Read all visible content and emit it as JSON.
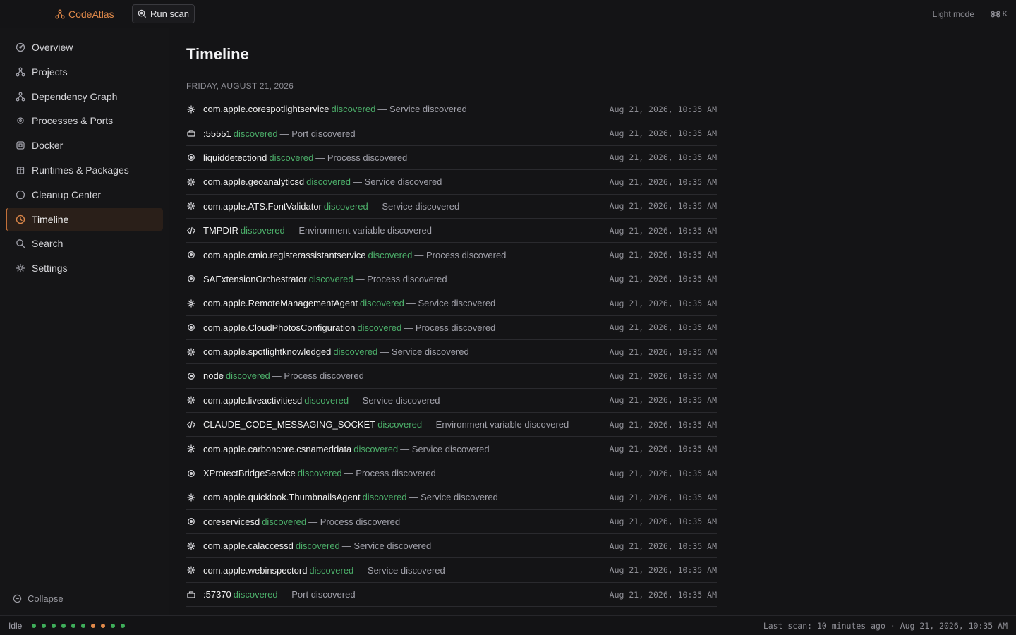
{
  "app": {
    "name": "CodeAtlas",
    "run_scan_label": "Run scan",
    "light_mode_label": "Light mode",
    "shortcut_key": "K",
    "accent_color": "#e0894a"
  },
  "sidebar": {
    "items": [
      {
        "label": "Overview",
        "icon": "overview-icon"
      },
      {
        "label": "Projects",
        "icon": "projects-icon"
      },
      {
        "label": "Dependency Graph",
        "icon": "graph-icon"
      },
      {
        "label": "Processes & Ports",
        "icon": "process-icon"
      },
      {
        "label": "Docker",
        "icon": "docker-icon"
      },
      {
        "label": "Runtimes & Packages",
        "icon": "package-icon"
      },
      {
        "label": "Cleanup Center",
        "icon": "cleanup-icon"
      },
      {
        "label": "Timeline",
        "icon": "clock-icon",
        "active": true
      },
      {
        "label": "Search",
        "icon": "search-icon"
      },
      {
        "label": "Settings",
        "icon": "gear-icon"
      }
    ],
    "collapse_label": "Collapse"
  },
  "main": {
    "title": "Timeline",
    "date_header": "FRIDAY, AUGUST 21, 2026",
    "events": [
      {
        "type": "service",
        "name": "com.apple.corespotlightservice",
        "verb": "discovered",
        "desc": "— Service discovered",
        "time": "Aug 21, 2026, 10:35 AM"
      },
      {
        "type": "port",
        "name": ":55551",
        "verb": "discovered",
        "desc": "— Port discovered",
        "time": "Aug 21, 2026, 10:35 AM"
      },
      {
        "type": "process",
        "name": "liquiddetectiond",
        "verb": "discovered",
        "desc": "— Process discovered",
        "time": "Aug 21, 2026, 10:35 AM"
      },
      {
        "type": "service",
        "name": "com.apple.geoanalyticsd",
        "verb": "discovered",
        "desc": "— Service discovered",
        "time": "Aug 21, 2026, 10:35 AM"
      },
      {
        "type": "service",
        "name": "com.apple.ATS.FontValidator",
        "verb": "discovered",
        "desc": "— Service discovered",
        "time": "Aug 21, 2026, 10:35 AM"
      },
      {
        "type": "env",
        "name": "TMPDIR",
        "verb": "discovered",
        "desc": "— Environment variable discovered",
        "time": "Aug 21, 2026, 10:35 AM"
      },
      {
        "type": "process",
        "name": "com.apple.cmio.registerassistantservice",
        "verb": "discovered",
        "desc": "— Process discovered",
        "time": "Aug 21, 2026, 10:35 AM"
      },
      {
        "type": "process",
        "name": "SAExtensionOrchestrator",
        "verb": "discovered",
        "desc": "— Process discovered",
        "time": "Aug 21, 2026, 10:35 AM"
      },
      {
        "type": "service",
        "name": "com.apple.RemoteManagementAgent",
        "verb": "discovered",
        "desc": "— Service discovered",
        "time": "Aug 21, 2026, 10:35 AM"
      },
      {
        "type": "process",
        "name": "com.apple.CloudPhotosConfiguration",
        "verb": "discovered",
        "desc": "— Process discovered",
        "time": "Aug 21, 2026, 10:35 AM"
      },
      {
        "type": "service",
        "name": "com.apple.spotlightknowledged",
        "verb": "discovered",
        "desc": "— Service discovered",
        "time": "Aug 21, 2026, 10:35 AM"
      },
      {
        "type": "process",
        "name": "node",
        "verb": "discovered",
        "desc": "— Process discovered",
        "time": "Aug 21, 2026, 10:35 AM"
      },
      {
        "type": "service",
        "name": "com.apple.liveactivitiesd",
        "verb": "discovered",
        "desc": "— Service discovered",
        "time": "Aug 21, 2026, 10:35 AM"
      },
      {
        "type": "env",
        "name": "CLAUDE_CODE_MESSAGING_SOCKET",
        "verb": "discovered",
        "desc": "— Environment variable discovered",
        "time": "Aug 21, 2026, 10:35 AM"
      },
      {
        "type": "service",
        "name": "com.apple.carboncore.csnameddata",
        "verb": "discovered",
        "desc": "— Service discovered",
        "time": "Aug 21, 2026, 10:35 AM"
      },
      {
        "type": "process",
        "name": "XProtectBridgeService",
        "verb": "discovered",
        "desc": "— Process discovered",
        "time": "Aug 21, 2026, 10:35 AM"
      },
      {
        "type": "service",
        "name": "com.apple.quicklook.ThumbnailsAgent",
        "verb": "discovered",
        "desc": "— Service discovered",
        "time": "Aug 21, 2026, 10:35 AM"
      },
      {
        "type": "process",
        "name": "coreservicesd",
        "verb": "discovered",
        "desc": "— Process discovered",
        "time": "Aug 21, 2026, 10:35 AM"
      },
      {
        "type": "service",
        "name": "com.apple.calaccessd",
        "verb": "discovered",
        "desc": "— Service discovered",
        "time": "Aug 21, 2026, 10:35 AM"
      },
      {
        "type": "service",
        "name": "com.apple.webinspectord",
        "verb": "discovered",
        "desc": "— Service discovered",
        "time": "Aug 21, 2026, 10:35 AM"
      },
      {
        "type": "port",
        "name": ":57370",
        "verb": "discovered",
        "desc": "— Port discovered",
        "time": "Aug 21, 2026, 10:35 AM"
      }
    ]
  },
  "statusbar": {
    "status": "Idle",
    "dot_colors": [
      "#3fae5a",
      "#3fae5a",
      "#3fae5a",
      "#3fae5a",
      "#3fae5a",
      "#3fae5a",
      "#e0894a",
      "#e0894a",
      "#3fae5a",
      "#3fae5a"
    ],
    "last_scan": "Last scan: 10 minutes ago · Aug 21, 2026, 10:35 AM"
  }
}
